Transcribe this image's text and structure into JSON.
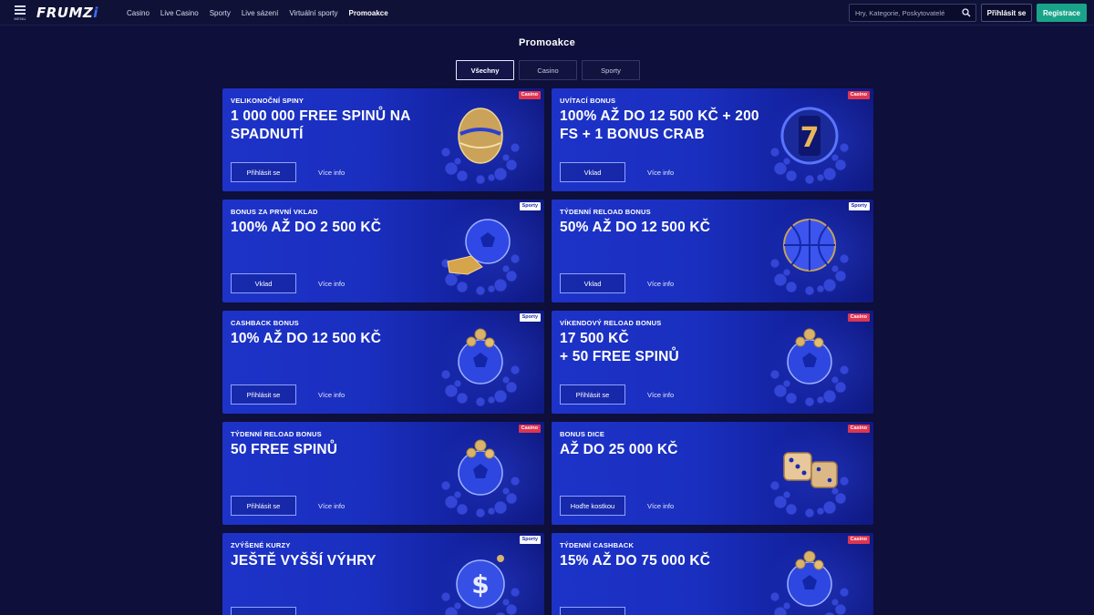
{
  "header": {
    "menu_label": "MENU",
    "logo_main": "FRUMZ",
    "logo_tail": "i",
    "nav": [
      "Casino",
      "Live Casino",
      "Sporty",
      "Live sázení",
      "Virtuální sporty",
      "Promoakce"
    ],
    "active_nav": "Promoakce",
    "search_placeholder": "Hry, Kategorie, Poskytovatelé",
    "login_label": "Přihlásit se",
    "register_label": "Registrace",
    "accent_color": "#19a48a"
  },
  "page": {
    "title": "Promoakce",
    "filters": [
      "Všechny",
      "Casino",
      "Sporty"
    ],
    "active_filter": "Všechny"
  },
  "promos": [
    {
      "subtitle": "VELIKONOČNÍ SPINY",
      "title": "1 000 000 FREE SPINŮ NA SPADNUTÍ",
      "badge": "Casino",
      "button": "Přihlásit se",
      "link": "Více info",
      "art": "golden-egg-icon"
    },
    {
      "subtitle": "UVÍTACÍ BONUS",
      "title": "100% AŽ DO 12 500 KČ + 200 FS + 1 BONUS CRAB",
      "badge": "Casino",
      "button": "Vklad",
      "link": "Více info",
      "art": "slot-reel-icon"
    },
    {
      "subtitle": "BONUS ZA PRVNÍ VKLAD",
      "title": "100% AŽ DO 2 500 KČ",
      "badge": "Sporty",
      "button": "Vklad",
      "link": "Více info",
      "art": "football-boot-icon"
    },
    {
      "subtitle": "TÝDENNÍ RELOAD BONUS",
      "title": "50% AŽ DO 12 500 KČ",
      "badge": "Sporty",
      "button": "Vklad",
      "link": "Více info",
      "art": "basketball-icon"
    },
    {
      "subtitle": "CASHBACK BONUS",
      "title": "10% AŽ DO 12 500 KČ",
      "badge": "Sporty",
      "button": "Přihlásit se",
      "link": "Více info",
      "art": "football-coins-icon"
    },
    {
      "subtitle": "VÍKENDOVÝ RELOAD BONUS",
      "title": "17 500 KČ\n+ 50 FREE SPINŮ",
      "badge": "Casino",
      "button": "Přihlásit se",
      "link": "Více info",
      "art": "football-coins-icon"
    },
    {
      "subtitle": "TÝDENNÍ RELOAD BONUS",
      "title": "50 FREE SPINŮ",
      "badge": "Casino",
      "button": "Přihlásit se",
      "link": "Více info",
      "art": "football-coins-icon"
    },
    {
      "subtitle": "BONUS DICE",
      "title": "AŽ DO 25 000 KČ",
      "badge": "Casino",
      "button": "Hoďte kostkou",
      "link": "Více info",
      "art": "dice-icon"
    },
    {
      "subtitle": "ZVÝŠENÉ KURZY",
      "title": "JEŠTĚ VYŠŠÍ VÝHRY",
      "badge": "Sporty",
      "button": "",
      "link": "",
      "art": "dollar-ball-icon"
    },
    {
      "subtitle": "TÝDENNÍ CASHBACK",
      "title": "15% AŽ DO 75 000 KČ",
      "badge": "Casino",
      "button": "",
      "link": "",
      "art": "football-coins-icon"
    }
  ]
}
